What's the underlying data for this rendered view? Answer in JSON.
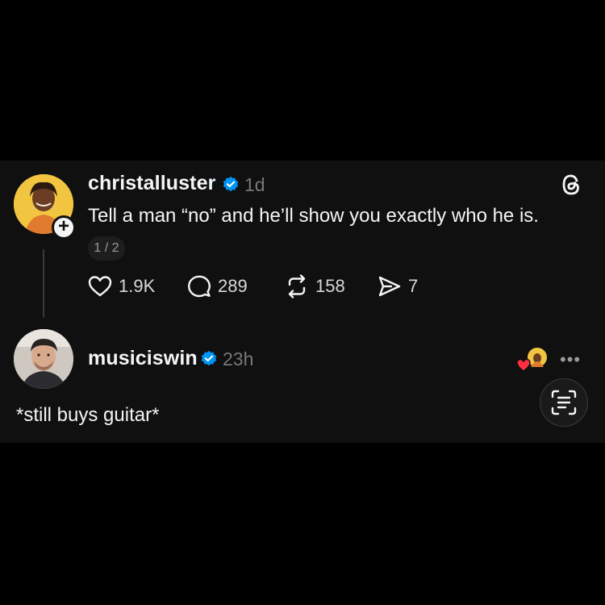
{
  "post": {
    "username": "christalluster",
    "time": "1d",
    "text": "Tell a man “no” and he’ll show you exactly who he is.",
    "pager": "1 / 2",
    "actions": {
      "likes": "1.9K",
      "replies": "289",
      "reposts": "158",
      "shares": "7"
    }
  },
  "reply": {
    "username": "musiciswin",
    "time": "23h",
    "text": "*still buys guitar*"
  },
  "icons": {
    "verified": "verified-badge-icon",
    "threads": "threads-logo-icon",
    "like": "heart-icon",
    "reply": "comment-bubble-icon",
    "repost": "repost-icon",
    "share": "send-icon",
    "more": "more-dots-icon",
    "scan": "text-scan-icon"
  },
  "colors": {
    "background": "#000000",
    "card": "#101010",
    "text": "#f3f5f7",
    "muted": "#777777",
    "verified": "#0095f6",
    "heart": "#ff3040"
  },
  "more_label": "•••"
}
